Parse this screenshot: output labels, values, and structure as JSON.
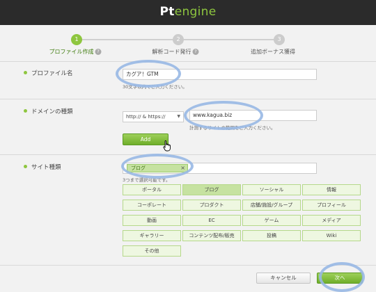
{
  "header": {
    "logo_pt": "Pt",
    "logo_rest": "engine"
  },
  "stepper": {
    "steps": [
      {
        "number": "1",
        "label": "プロファイル作成",
        "active": true
      },
      {
        "number": "2",
        "label": "解析コード発行",
        "active": false
      },
      {
        "number": "3",
        "label": "追加ボーナス獲得",
        "active": false
      }
    ],
    "help_glyph": "?"
  },
  "profile_name": {
    "label": "プロファイル名",
    "value": "カグア！GTM",
    "hint": "30文字以内でご入力ください。"
  },
  "domain": {
    "label": "ドメインの種類",
    "protocol": "http:// & https://",
    "value": "www.kagua.biz",
    "hint": "計測するサイトの範囲をご入力ください。",
    "add_button": "Add"
  },
  "site_type": {
    "label": "サイト種類",
    "selected_tag": "ブログ",
    "tag_remove": "×",
    "hint": "3つまで選択可能です。",
    "categories": [
      "ポータル",
      "ブログ",
      "ソーシャル",
      "情報",
      "コーポレート",
      "プロダクト",
      "店舗/施設/グループ",
      "プロフィール",
      "動画",
      "EC",
      "ゲーム",
      "メディア",
      "ギャラリー",
      "コンテンツ配布/販売",
      "投稿",
      "Wiki",
      "その他"
    ],
    "selected": [
      "ブログ"
    ]
  },
  "footer": {
    "cancel_button": "キャンセル",
    "next_button": "次へ"
  },
  "colors": {
    "accent": "#8ec63f",
    "highlight_circle": "#98b8e4",
    "topbar": "#2b2b2b"
  }
}
